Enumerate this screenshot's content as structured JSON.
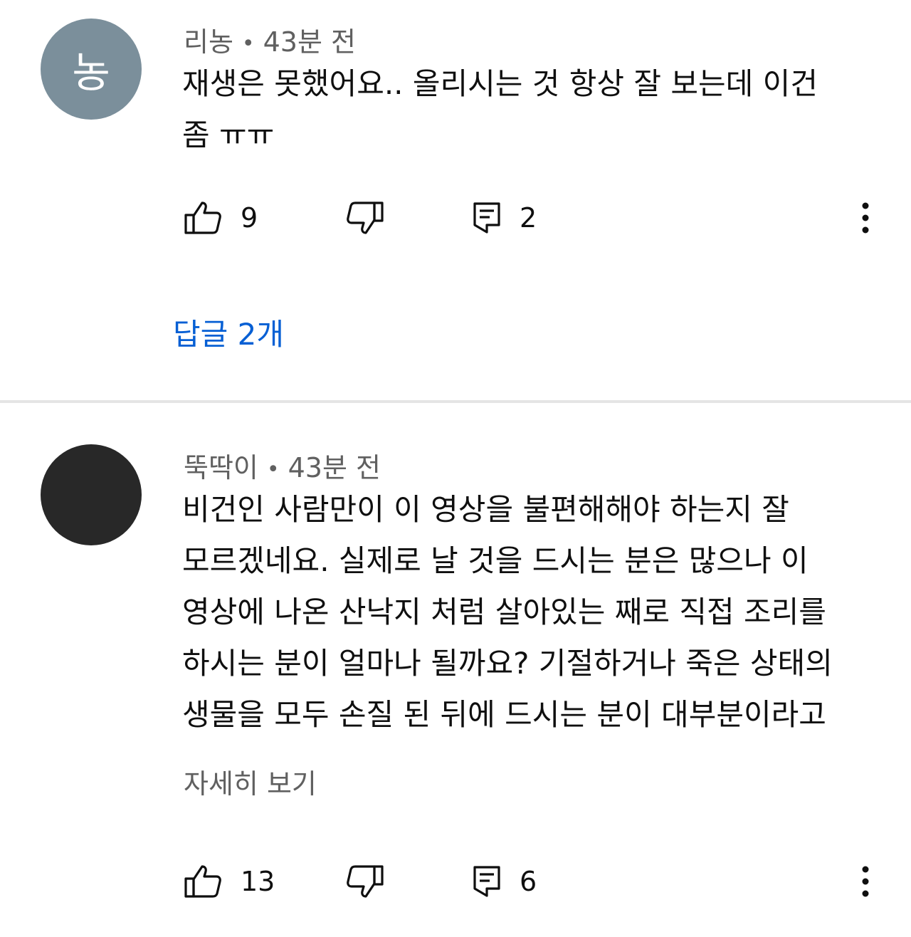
{
  "comments": [
    {
      "avatar_letter": "농",
      "avatar_color": "#7b8f9b",
      "author": "리농",
      "separator": "•",
      "time": "43분 전",
      "text": "재생은 못했어요.. 올리시는 것 항상 잘 보는데 이건\n좀 ㅠㅠ",
      "likes": "9",
      "replies_count": "2",
      "replies_label": "답글 2개"
    },
    {
      "avatar_letter": "",
      "avatar_color": "#282828",
      "author": "뚝딱이",
      "separator": "•",
      "time": "43분 전",
      "text": "비건인 사람만이 이 영상을 불편해해야 하는지 잘\n모르겠네요. 실제로 날 것을 드시는 분은 많으나 이\n영상에 나온 산낙지 처럼 살아있는 째로 직접 조리를\n하시는 분이 얼마나 될까요? 기절하거나 죽은 상태의\n생물을 모두 손질 된 뒤에 드시는 분이 대부분이라고",
      "more_label": "자세히 보기",
      "likes": "13",
      "replies_count": "6"
    }
  ],
  "icons": {
    "like": "thumbs-up-icon",
    "dislike": "thumbs-down-icon",
    "reply": "comment-icon",
    "more": "more-vertical-icon"
  },
  "colors": {
    "link_blue": "#065fd4",
    "secondary_text": "#606060",
    "divider": "#e5e5e5"
  }
}
